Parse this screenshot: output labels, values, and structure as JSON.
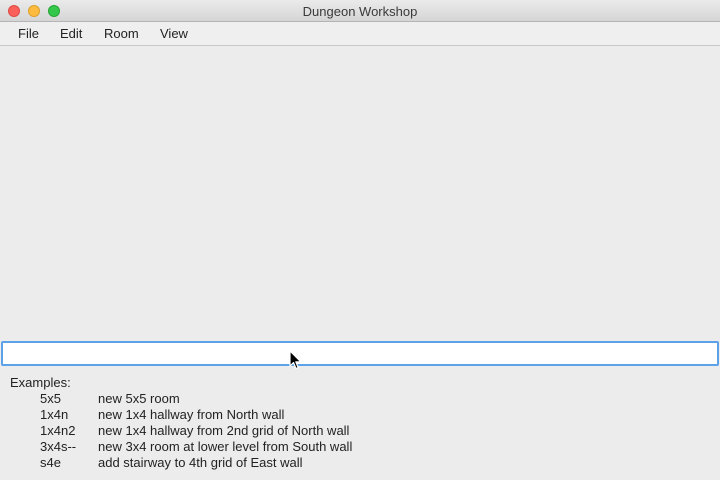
{
  "window": {
    "title": "Dungeon Workshop"
  },
  "menu": {
    "items": [
      {
        "label": "File"
      },
      {
        "label": "Edit"
      },
      {
        "label": "Room"
      },
      {
        "label": "View"
      }
    ]
  },
  "command": {
    "value": "",
    "placeholder": ""
  },
  "examples": {
    "heading": "Examples:",
    "rows": [
      {
        "cmd": "5x5",
        "desc": "new 5x5 room"
      },
      {
        "cmd": "1x4n",
        "desc": "new 1x4 hallway from North wall"
      },
      {
        "cmd": "1x4n2",
        "desc": "new 1x4 hallway from 2nd grid of North wall"
      },
      {
        "cmd": "3x4s--",
        "desc": "new 3x4 room at lower level from South wall"
      },
      {
        "cmd": "s4e",
        "desc": "add stairway to 4th grid of East wall"
      }
    ]
  },
  "colors": {
    "input_focus": "#5da2e8",
    "close": "#fc605b",
    "minimize": "#fdbc40",
    "zoom": "#34c84a"
  },
  "icons": [
    "close-button",
    "minimize-button",
    "zoom-button",
    "mouse-pointer-icon"
  ]
}
